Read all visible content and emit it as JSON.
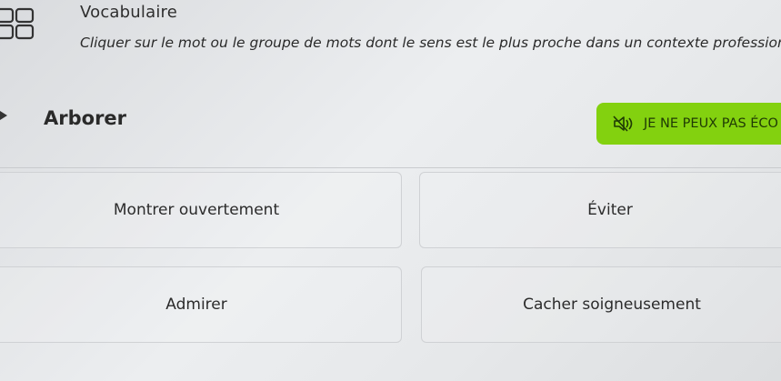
{
  "header": {
    "title": "Vocabulaire",
    "instruction": "Cliquer sur le mot ou le groupe de mots dont le sens est le plus proche dans un contexte professionnel."
  },
  "question": {
    "word": "Arborer",
    "cant_listen_label": "JE NE PEUX PAS ÉCO"
  },
  "options": [
    {
      "label": "Montrer ouvertement"
    },
    {
      "label": "Éviter"
    },
    {
      "label": "Admirer"
    },
    {
      "label": "Cacher soigneusement"
    }
  ],
  "colors": {
    "accent_green": "#83d10f",
    "text": "#2b2b2b",
    "border": "#cfd1d4"
  },
  "icons": {
    "header": "vocabulary-grid-icon",
    "audio": "speaker-muted-icon",
    "play": "play-arrow-icon"
  }
}
